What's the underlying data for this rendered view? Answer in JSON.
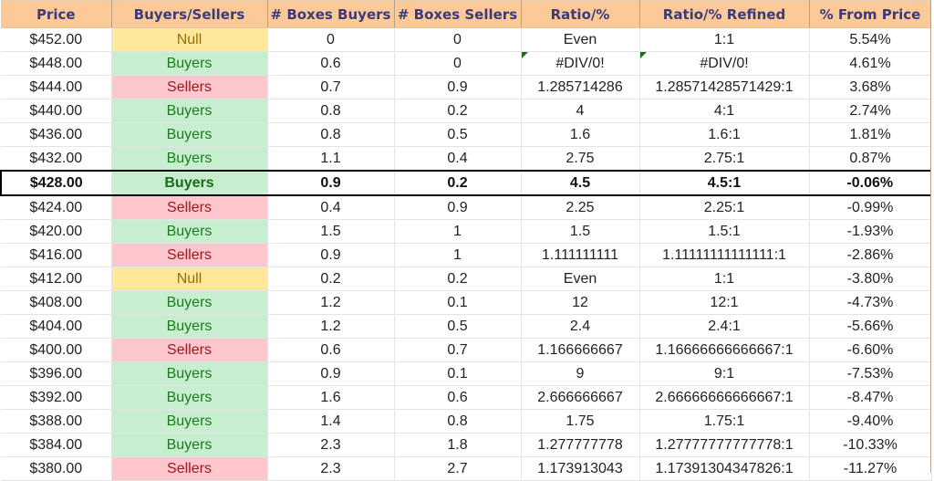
{
  "headers": [
    "Price",
    "Buyers/Sellers",
    "# Boxes Buyers",
    "# Boxes Sellers",
    "Ratio/%",
    "Ratio/% Refined",
    "% From Price"
  ],
  "current_price_row": 6,
  "colors": {
    "header_bg": "#fcc999",
    "header_text": "#3d3a78",
    "null_bg": "#ffe89b",
    "buyers_bg": "#c7efcf",
    "sellers_bg": "#fec7cd",
    "error_flag": "#1e6b1e"
  },
  "rows": [
    {
      "price": "$452.00",
      "side": "Null",
      "buyers": "0",
      "sellers": "0",
      "ratio": "Even",
      "refined": "1:1",
      "pct": "5.54%"
    },
    {
      "price": "$448.00",
      "side": "Buyers",
      "buyers": "0.6",
      "sellers": "0",
      "ratio": "#DIV/0!",
      "refined": "#DIV/0!",
      "pct": "4.61%",
      "error": true
    },
    {
      "price": "$444.00",
      "side": "Sellers",
      "buyers": "0.7",
      "sellers": "0.9",
      "ratio": "1.285714286",
      "refined": "1.28571428571429:1",
      "pct": "3.68%"
    },
    {
      "price": "$440.00",
      "side": "Buyers",
      "buyers": "0.8",
      "sellers": "0.2",
      "ratio": "4",
      "refined": "4:1",
      "pct": "2.74%"
    },
    {
      "price": "$436.00",
      "side": "Buyers",
      "buyers": "0.8",
      "sellers": "0.5",
      "ratio": "1.6",
      "refined": "1.6:1",
      "pct": "1.81%"
    },
    {
      "price": "$432.00",
      "side": "Buyers",
      "buyers": "1.1",
      "sellers": "0.4",
      "ratio": "2.75",
      "refined": "2.75:1",
      "pct": "0.87%"
    },
    {
      "price": "$428.00",
      "side": "Buyers",
      "buyers": "0.9",
      "sellers": "0.2",
      "ratio": "4.5",
      "refined": "4.5:1",
      "pct": "-0.06%"
    },
    {
      "price": "$424.00",
      "side": "Sellers",
      "buyers": "0.4",
      "sellers": "0.9",
      "ratio": "2.25",
      "refined": "2.25:1",
      "pct": "-0.99%"
    },
    {
      "price": "$420.00",
      "side": "Buyers",
      "buyers": "1.5",
      "sellers": "1",
      "ratio": "1.5",
      "refined": "1.5:1",
      "pct": "-1.93%"
    },
    {
      "price": "$416.00",
      "side": "Sellers",
      "buyers": "0.9",
      "sellers": "1",
      "ratio": "1.111111111",
      "refined": "1.11111111111111:1",
      "pct": "-2.86%"
    },
    {
      "price": "$412.00",
      "side": "Null",
      "buyers": "0.2",
      "sellers": "0.2",
      "ratio": "Even",
      "refined": "1:1",
      "pct": "-3.80%"
    },
    {
      "price": "$408.00",
      "side": "Buyers",
      "buyers": "1.2",
      "sellers": "0.1",
      "ratio": "12",
      "refined": "12:1",
      "pct": "-4.73%"
    },
    {
      "price": "$404.00",
      "side": "Buyers",
      "buyers": "1.2",
      "sellers": "0.5",
      "ratio": "2.4",
      "refined": "2.4:1",
      "pct": "-5.66%"
    },
    {
      "price": "$400.00",
      "side": "Sellers",
      "buyers": "0.6",
      "sellers": "0.7",
      "ratio": "1.166666667",
      "refined": "1.16666666666667:1",
      "pct": "-6.60%"
    },
    {
      "price": "$396.00",
      "side": "Buyers",
      "buyers": "0.9",
      "sellers": "0.1",
      "ratio": "9",
      "refined": "9:1",
      "pct": "-7.53%"
    },
    {
      "price": "$392.00",
      "side": "Buyers",
      "buyers": "1.6",
      "sellers": "0.6",
      "ratio": "2.666666667",
      "refined": "2.66666666666667:1",
      "pct": "-8.47%"
    },
    {
      "price": "$388.00",
      "side": "Buyers",
      "buyers": "1.4",
      "sellers": "0.8",
      "ratio": "1.75",
      "refined": "1.75:1",
      "pct": "-9.40%"
    },
    {
      "price": "$384.00",
      "side": "Buyers",
      "buyers": "2.3",
      "sellers": "1.8",
      "ratio": "1.277777778",
      "refined": "1.27777777777778:1",
      "pct": "-10.33%"
    },
    {
      "price": "$380.00",
      "side": "Sellers",
      "buyers": "2.3",
      "sellers": "2.7",
      "ratio": "1.173913043",
      "refined": "1.17391304347826:1",
      "pct": "-11.27%"
    }
  ]
}
